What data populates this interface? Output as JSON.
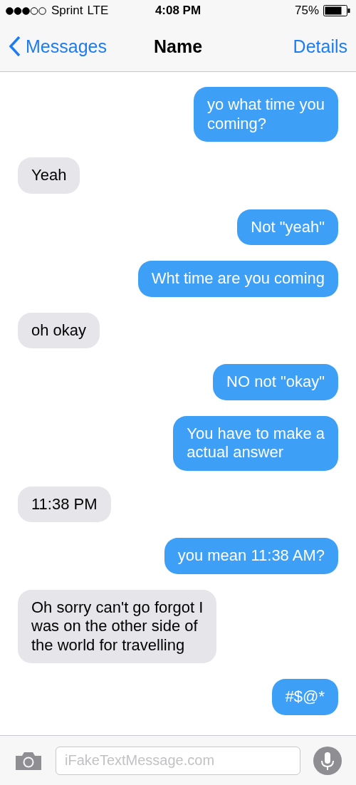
{
  "status_bar": {
    "carrier": "Sprint",
    "network": "LTE",
    "time": "4:08 PM",
    "battery": "75%"
  },
  "nav_bar": {
    "back": "Messages",
    "title": "Name",
    "action": "Details"
  },
  "messages": [
    {
      "kind": "sent",
      "text": "yo what time you\ncoming?"
    },
    {
      "kind": "received",
      "text": "Yeah"
    },
    {
      "kind": "sent",
      "text": "Not \"yeah\""
    },
    {
      "kind": "sent",
      "text": "Wht time are you coming"
    },
    {
      "kind": "received",
      "text": "oh okay"
    },
    {
      "kind": "sent",
      "text": "NO not \"okay\""
    },
    {
      "kind": "sent",
      "text": "You have to make a\nactual answer"
    },
    {
      "kind": "received",
      "text": "11:38 PM"
    },
    {
      "kind": "sent",
      "text": "you mean 11:38 AM?"
    },
    {
      "kind": "received",
      "text": "Oh sorry can't go forgot I\nwas on the other side of\nthe world for travelling"
    },
    {
      "kind": "sent",
      "text": "#$@*"
    }
  ],
  "composer": {
    "placeholder": "iFakeTextMessage.com"
  }
}
